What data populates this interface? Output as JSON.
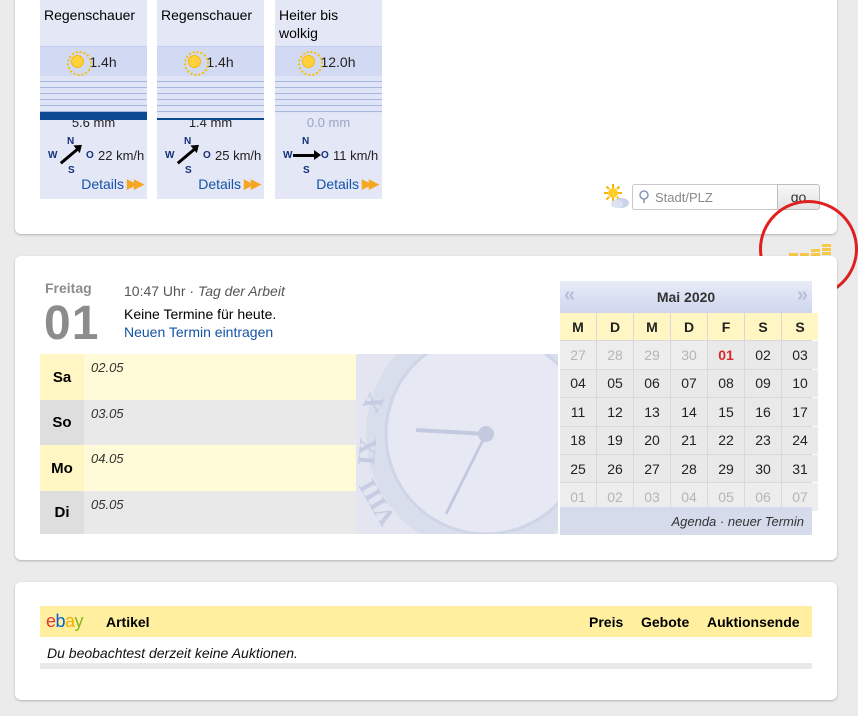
{
  "weather": {
    "days": [
      {
        "condition": "Regenschauer",
        "sun_hours": "1.4h",
        "rain": "5.6 mm",
        "rain_level": 0.8,
        "rain_dim": false,
        "wind_speed": "22 km/h",
        "wind_direction": "SW",
        "details": "Details"
      },
      {
        "condition": "Regenschauer",
        "sun_hours": "1.4h",
        "rain": "1.4 mm",
        "rain_level": 0.2,
        "rain_dim": false,
        "wind_speed": "25 km/h",
        "wind_direction": "SW",
        "details": "Details"
      },
      {
        "condition": "Heiter bis wolkig",
        "sun_hours": "12.0h",
        "rain": "0.0 mm",
        "rain_level": 0.0,
        "rain_dim": true,
        "wind_speed": "11 km/h",
        "wind_direction": "W",
        "details": "Details"
      }
    ],
    "compass": {
      "n": "N",
      "s": "S",
      "w": "W",
      "o": "O"
    },
    "search": {
      "placeholder": "Stadt/PLZ",
      "button": "go"
    }
  },
  "calendar": {
    "day_name": "Freitag",
    "day_number": "01",
    "time": "10:47 Uhr",
    "separator": "·",
    "holiday": "Tag der Arbeit",
    "no_events": "Keine Termine für heute.",
    "new_event_link": "Neuen Termin eintragen",
    "week": [
      {
        "day": "Sa",
        "date": "02.05",
        "style": "yellow"
      },
      {
        "day": "So",
        "date": "03.05",
        "style": "grey"
      },
      {
        "day": "Mo",
        "date": "04.05",
        "style": "yellow"
      },
      {
        "day": "Di",
        "date": "05.05",
        "style": "grey"
      }
    ],
    "mini": {
      "month_title": "Mai 2020",
      "prev": "«",
      "next": "»",
      "weekday_headers": [
        "M",
        "D",
        "M",
        "D",
        "F",
        "S",
        "S"
      ],
      "weeks": [
        [
          "27",
          "28",
          "29",
          "30",
          "01",
          "02",
          "03"
        ],
        [
          "04",
          "05",
          "06",
          "07",
          "08",
          "09",
          "10"
        ],
        [
          "11",
          "12",
          "13",
          "14",
          "15",
          "16",
          "17"
        ],
        [
          "18",
          "19",
          "20",
          "21",
          "22",
          "23",
          "24"
        ],
        [
          "25",
          "26",
          "27",
          "28",
          "29",
          "30",
          "31"
        ],
        [
          "01",
          "02",
          "03",
          "04",
          "05",
          "06",
          "07"
        ]
      ],
      "today": "01",
      "footer_agenda": "Agenda",
      "footer_separator": "·",
      "footer_new": "neuer Termin"
    }
  },
  "ebay": {
    "logo": {
      "e": "e",
      "b": "b",
      "a": "a",
      "y": "y"
    },
    "columns": {
      "artikel": "Artikel",
      "preis": "Preis",
      "gebote": "Gebote",
      "ende": "Auktionsende"
    },
    "empty_message": "Du beobachtest derzeit keine Auktionen."
  },
  "colors": {
    "link": "#1553a6",
    "accent_orange": "#f5a623",
    "today_red": "#d62a2a",
    "annotation_circle": "#e02020"
  }
}
